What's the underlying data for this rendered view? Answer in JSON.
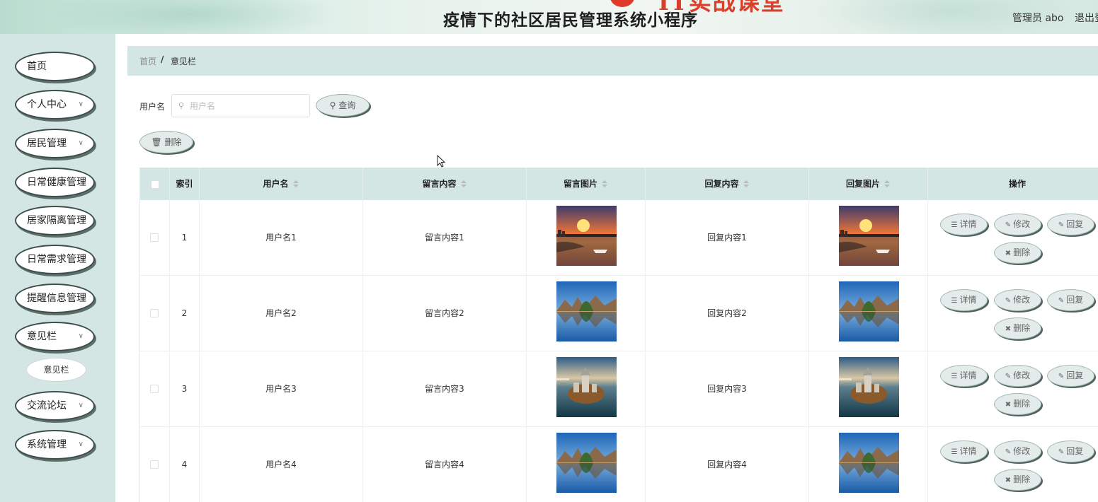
{
  "header": {
    "title": "疫情下的社区居民管理系统小程序",
    "user_label": "管理员 abo",
    "logout_label": "退出登"
  },
  "sidebar": {
    "items": [
      {
        "label": "首页",
        "has_arrow": false
      },
      {
        "label": "个人中心",
        "has_arrow": true
      },
      {
        "label": "居民管理",
        "has_arrow": true
      },
      {
        "label": "日常健康管理",
        "has_arrow": false
      },
      {
        "label": "居家隔离管理",
        "has_arrow": false
      },
      {
        "label": "日常需求管理",
        "has_arrow": false
      },
      {
        "label": "提醒信息管理",
        "has_arrow": false
      },
      {
        "label": "意见栏",
        "has_arrow": true
      },
      {
        "label": "交流论坛",
        "has_arrow": true
      },
      {
        "label": "系统管理",
        "has_arrow": true
      }
    ],
    "sub_item": "意见栏"
  },
  "breadcrumb": {
    "home": "首页",
    "separator": "/",
    "current": "意见栏"
  },
  "search": {
    "label": "用户名",
    "placeholder": "用户名",
    "value": "",
    "button_label": "查询"
  },
  "toolbar": {
    "delete_label": "删除"
  },
  "table": {
    "headers": {
      "index": "索引",
      "username": "用户名",
      "message": "留言内容",
      "message_image": "留言图片",
      "reply": "回复内容",
      "reply_image": "回复图片",
      "actions": "操作"
    },
    "rows": [
      {
        "index": "1",
        "username": "用户名1",
        "message": "留言内容1",
        "reply": "回复内容1",
        "image": "sunset-harbor"
      },
      {
        "index": "2",
        "username": "用户名2",
        "message": "留言内容2",
        "reply": "回复内容2",
        "image": "mountain-lake"
      },
      {
        "index": "3",
        "username": "用户名3",
        "message": "留言内容3",
        "reply": "回复内容3",
        "image": "island-castle"
      },
      {
        "index": "4",
        "username": "用户名4",
        "message": "留言内容4",
        "reply": "回复内容4",
        "image": "mountain-lake"
      }
    ],
    "actions": {
      "detail": "详情",
      "edit": "修改",
      "reply": "回复",
      "delete": "删除"
    }
  },
  "colors": {
    "sidebar_bg": "#d4e6e3",
    "header_bg": "#d4e6e3",
    "button_border": "#3d4f4a"
  }
}
